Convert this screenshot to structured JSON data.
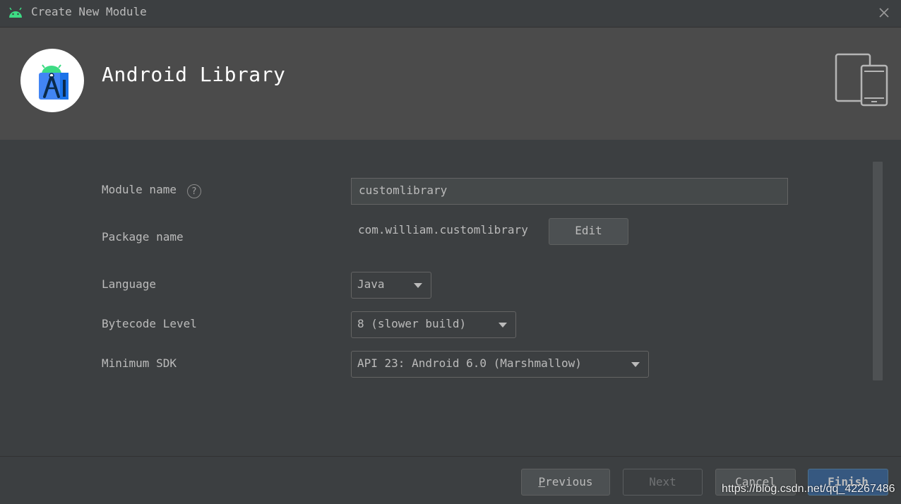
{
  "window": {
    "title": "Create New Module"
  },
  "header": {
    "heading": "Android Library",
    "logo_icon": "android-studio-logo",
    "devices_icon": "tablet-phone-icon"
  },
  "form": {
    "module_name": {
      "label": "Module name",
      "value": "customlibrary"
    },
    "package_name": {
      "label": "Package name",
      "value": "com.william.customlibrary",
      "edit_label": "Edit"
    },
    "language": {
      "label": "Language",
      "value": "Java"
    },
    "bytecode_level": {
      "label": "Bytecode Level",
      "value": "8 (slower build)"
    },
    "minimum_sdk": {
      "label": "Minimum SDK",
      "value": "API 23: Android 6.0 (Marshmallow)"
    }
  },
  "footer": {
    "previous_first": "P",
    "previous_rest": "revious",
    "next": "Next",
    "cancel_first": "C",
    "cancel_rest": "ancel",
    "finish_first": "F",
    "finish_rest": "inish"
  },
  "watermark": "https://blog.csdn.net/qq_42267486",
  "colors": {
    "background": "#3c3f41",
    "header": "#4b4b4b",
    "primary": "#365880",
    "android_green": "#3ddc84"
  }
}
